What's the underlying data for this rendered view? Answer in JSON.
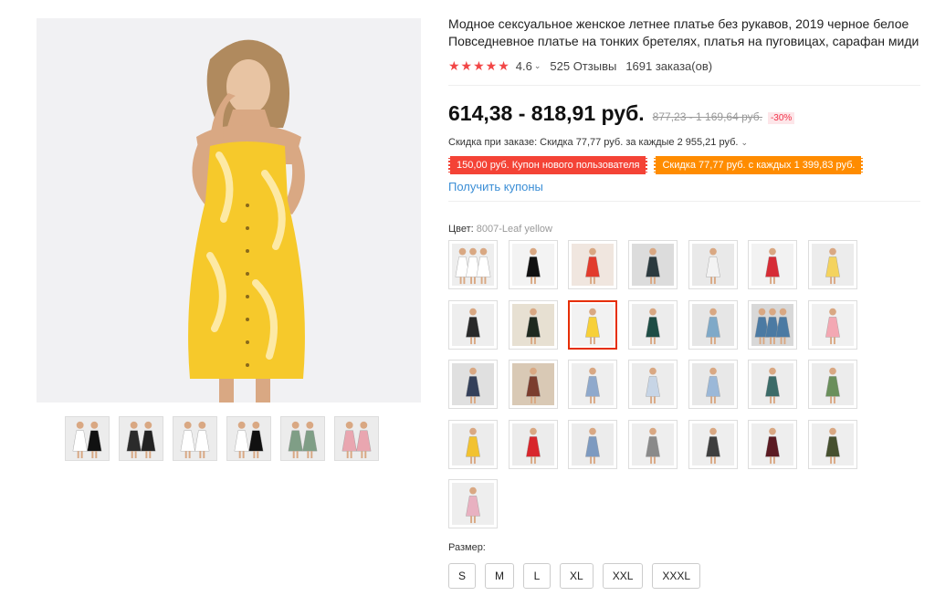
{
  "product": {
    "title": "Модное сексуальное женское летнее платье без рукавов, 2019 черное белое Повседневное платье на тонких бретелях, платья на пуговицах, сарафан миди",
    "rating": "4.6",
    "reviews": "525 Отзывы",
    "orders": "1691 заказа(ов)",
    "price": "614,38 - 818,91 руб.",
    "old_price": "877,23 - 1 169,64 руб.",
    "discount": "-30%",
    "order_discount": "Скидка при заказе: Скидка 77,77 руб. за каждые 2 955,21 руб.",
    "coupon_new_user": "150,00 руб. Купон нового пользователя",
    "coupon_discount": "Скидка 77,77 руб. с каждых 1 399,83 руб.",
    "get_coupons": "Получить купоны",
    "color_label": "Цвет:",
    "color_value": "8007-Leaf yellow",
    "size_label": "Размер:",
    "sizes": [
      "S",
      "M",
      "L",
      "XL",
      "XXL",
      "XXXL"
    ]
  },
  "colors": {
    "star": "#f24646",
    "price_badge": "#f2334a",
    "coupon_red": "#f44336",
    "coupon_orange": "#ff8c00",
    "link": "#3b8ed6",
    "selected_border": "#e62e04"
  },
  "swatches": [
    {
      "name": "white-trio",
      "dress": "#ffffff",
      "bg": "#eeeeee",
      "count": 3
    },
    {
      "name": "black",
      "dress": "#111111",
      "bg": "#f3f3f3",
      "count": 1
    },
    {
      "name": "red",
      "dress": "#e23b2c",
      "bg": "#f0e6df",
      "count": 1
    },
    {
      "name": "dark-floral",
      "dress": "#2b3a3f",
      "bg": "#dcdcdc",
      "count": 1
    },
    {
      "name": "white-floral",
      "dress": "#f3f3f3",
      "bg": "#e9e9e9",
      "count": 1
    },
    {
      "name": "red-floral",
      "dress": "#d62c36",
      "bg": "#f2f2f2",
      "count": 1
    },
    {
      "name": "yellow-floral",
      "dress": "#f4d35e",
      "bg": "#ececec",
      "count": 1
    },
    {
      "name": "black-yellow-floral",
      "dress": "#2a2a2a",
      "bg": "#eeeeee",
      "count": 1
    },
    {
      "name": "black-leaf",
      "dress": "#1f2a1f",
      "bg": "#e7e0d2",
      "count": 1
    },
    {
      "name": "leaf-yellow",
      "dress": "#f7d038",
      "bg": "#f2f2f2",
      "count": 1
    },
    {
      "name": "green-floral",
      "dress": "#1e4d45",
      "bg": "#ececec",
      "count": 1
    },
    {
      "name": "blue-white-floral",
      "dress": "#7fa9c8",
      "bg": "#e6e6e6",
      "count": 1
    },
    {
      "name": "blue-floral-trio",
      "dress": "#4b7aa3",
      "bg": "#d8d8d8",
      "count": 3
    },
    {
      "name": "pink-stripe",
      "dress": "#f3a8b3",
      "bg": "#f0f0f0",
      "count": 1
    },
    {
      "name": "navy-dots",
      "dress": "#34405a",
      "bg": "#e0e0e0",
      "count": 1
    },
    {
      "name": "floral-print",
      "dress": "#7b3d2e",
      "bg": "#d9c9b5",
      "count": 1
    },
    {
      "name": "blue-stripe",
      "dress": "#8fa9cc",
      "bg": "#eeeeee",
      "count": 1
    },
    {
      "name": "light-blue",
      "dress": "#c7d5e6",
      "bg": "#ececec",
      "count": 1
    },
    {
      "name": "sky-floral",
      "dress": "#9bb8d8",
      "bg": "#e8e8e8",
      "count": 1
    },
    {
      "name": "teal-floral",
      "dress": "#3b6b68",
      "bg": "#ececec",
      "count": 1
    },
    {
      "name": "green-leaf",
      "dress": "#6a8f5b",
      "bg": "#ececec",
      "count": 1
    },
    {
      "name": "yellow",
      "dress": "#f2c230",
      "bg": "#ececec",
      "count": 1
    },
    {
      "name": "red-solid",
      "dress": "#d8262c",
      "bg": "#ececec",
      "count": 1
    },
    {
      "name": "denim-blue",
      "dress": "#7d9ac0",
      "bg": "#ececec",
      "count": 1
    },
    {
      "name": "grey-stripe",
      "dress": "#8a8a8a",
      "bg": "#eeeeee",
      "count": 1
    },
    {
      "name": "dark-grey",
      "dress": "#3f3f3f",
      "bg": "#eeeeee",
      "count": 1
    },
    {
      "name": "wine",
      "dress": "#5b1a22",
      "bg": "#eeeeee",
      "count": 1
    },
    {
      "name": "army-green",
      "dress": "#46502f",
      "bg": "#eeeeee",
      "count": 1
    },
    {
      "name": "pink-floral",
      "dress": "#e8b1c1",
      "bg": "#eeeeee",
      "count": 1
    }
  ],
  "selected_swatch_index": 9,
  "gallery_thumbs": [
    {
      "dress": "#ffffff",
      "second": "#111111"
    },
    {
      "dress": "#2b2b2b",
      "second": "#222222"
    },
    {
      "dress": "#ffffff",
      "second": "#ffffff"
    },
    {
      "dress": "#ffffff",
      "second": "#111111"
    },
    {
      "dress": "#7f9e86",
      "second": "#7f9e86"
    },
    {
      "dress": "#e9a6b0",
      "second": "#e9a6b0"
    }
  ]
}
